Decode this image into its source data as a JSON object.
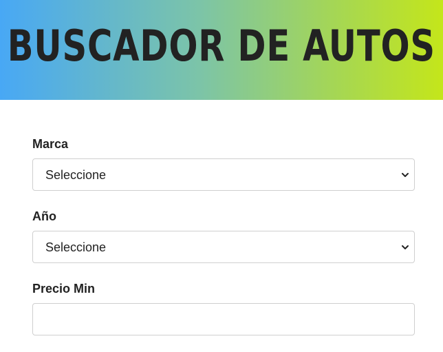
{
  "header": {
    "title": "BUSCADOR DE AUTOS"
  },
  "form": {
    "fields": [
      {
        "label": "Marca",
        "value": "Seleccione"
      },
      {
        "label": "Año",
        "value": "Seleccione"
      },
      {
        "label": "Precio Min",
        "value": ""
      }
    ]
  },
  "colors": {
    "gradient_start": "#48a8f5",
    "gradient_end": "#c4e61a",
    "text": "#222222",
    "border": "#cfcfcf"
  },
  "icons": {
    "select_arrow": "chevron-down-icon"
  }
}
